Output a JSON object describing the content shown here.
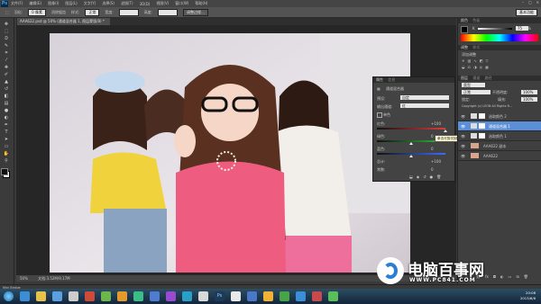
{
  "menu": {
    "app_logo": "Ps",
    "items": [
      "文件(F)",
      "编辑(E)",
      "图像(I)",
      "图层(L)",
      "文字(Y)",
      "选择(S)",
      "滤镜(T)",
      "3D(D)",
      "视图(V)",
      "窗口(W)",
      "帮助(H)"
    ],
    "window_controls": [
      "–",
      "□",
      "✕"
    ]
  },
  "options": {
    "feather_label": "羽化:",
    "feather_value": "0 像素",
    "antialias": "消除锯齿",
    "style_label": "样式:",
    "style_value": "正常",
    "width_label": "宽度:",
    "height_label": "高度:",
    "refine_edge": "调整边缘...",
    "workspace": "基本功能"
  },
  "document": {
    "tab_title": "AAA622.psd @ 50% (通道混合器 1, 图层蒙版/8) *",
    "zoom": "50%",
    "doc_info": "文档:3.52M/9.17M"
  },
  "color_panel": {
    "tabs": [
      "颜色",
      "色板"
    ],
    "k_label": "K",
    "k_value": "75",
    "percent": "%"
  },
  "adjust_panel": {
    "tabs": [
      "调整",
      "样式"
    ],
    "title": "添加调整"
  },
  "properties": {
    "tabs": [
      "属性",
      "信息"
    ],
    "title": "通道混合器",
    "preset_label": "预设:",
    "preset_value": "自定",
    "output_label": "输出通道:",
    "output_value": "红",
    "mono_label": "单色",
    "sliders": [
      {
        "label": "红色:",
        "value": "+100",
        "pos": 1.0,
        "color": "#e03b3b"
      },
      {
        "label": "绿色:",
        "value": "0",
        "pos": 0.5,
        "color": "#2fbf3a"
      },
      {
        "label": "蓝色:",
        "value": "0",
        "pos": 0.5,
        "color": "#3a6cff"
      }
    ],
    "total_label": "总计:",
    "total_value": "+100",
    "constant_label": "常数:",
    "constant_value": "0",
    "tooltip": "单击可剪切到图层 (单击可影响下面的所有图层)"
  },
  "layers": {
    "tabs": [
      "图层",
      "通道",
      "路径"
    ],
    "kind_label": "类型",
    "blend_mode": "正常",
    "opacity_label": "不透明度:",
    "opacity_value": "100%",
    "lock_label": "锁定:",
    "fill_label": "填充:",
    "fill_value": "100%",
    "copyright": "Copyright (c) LEON All Rights R...",
    "items": [
      {
        "name": "选取颜色 2",
        "type": "adjust"
      },
      {
        "name": "通道混合器 1",
        "type": "adjust"
      },
      {
        "name": "选取颜色 1",
        "type": "adjust"
      },
      {
        "name": "AAA622 副本",
        "type": "photo"
      },
      {
        "name": "AAA622",
        "type": "photo"
      }
    ]
  },
  "bottom": {
    "mini_bridge": "Mini Bridge",
    "time": "20:08",
    "date": "2013/6/6"
  },
  "watermark": {
    "brand": "电脑百事网",
    "url": "WWW.PC841.COM"
  },
  "colors": {
    "ui_dark": "#3a3a3a",
    "highlight": "#5b8fd8",
    "brand_blue": "#2a7fd4"
  }
}
